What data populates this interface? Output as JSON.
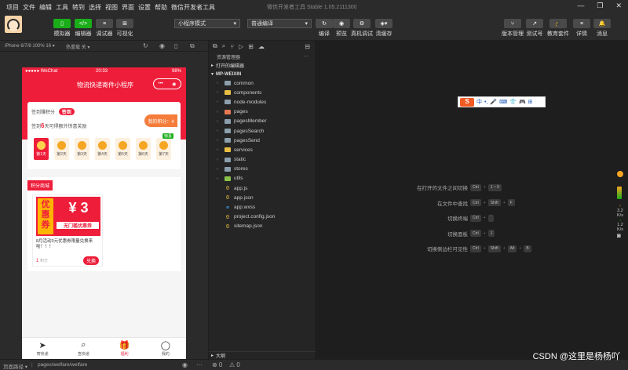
{
  "menu": [
    "项目",
    "文件",
    "编辑",
    "工具",
    "转到",
    "选择",
    "视图",
    "界面",
    "设置",
    "帮助",
    "微信开发者工具"
  ],
  "window_title": "微信开发者工具 Stable 1.05.2111300",
  "toolbar": {
    "left_buttons": [
      {
        "label": "模拟器",
        "icon": "phone-icon"
      },
      {
        "label": "编辑器",
        "icon": "code-icon"
      },
      {
        "label": "调试器",
        "icon": "debug-icon"
      },
      {
        "label": "可视化",
        "icon": "visual-icon"
      }
    ],
    "mode_select": "小程序模式",
    "compile_select": "普通编译",
    "mid_buttons": [
      "编译",
      "预览",
      "真机调试",
      "清缓存"
    ],
    "right_buttons": [
      "版本管理",
      "测试号",
      "教育套件",
      "详情",
      "消息"
    ]
  },
  "sim": {
    "device": "iPhone 6/7/8 100% 16 ▾",
    "hotreload": "热重载 关 ▾"
  },
  "phone": {
    "carrier": "●●●●● WeChat",
    "time": "20:33",
    "battery": "98%",
    "nav_title": "物流快递寄件小程序",
    "sign_text1": "签到赚积分",
    "sign_btn": "签到",
    "sign_text2_pre": "签到",
    "sign_days": "6",
    "sign_text2_post": "天可得额外惊喜奖励",
    "my_points": "我的积分：4",
    "days": [
      "第1天",
      "第2天",
      "第3天",
      "第4天",
      "第5天",
      "第6天",
      "第7天"
    ],
    "day7_tag": "惊喜",
    "shop_tag": "积分商城",
    "coupon_left": "优惠券",
    "coupon_amount": "¥ 3",
    "coupon_sub": "无门槛优惠券",
    "coupon_desc": "8月活动3元优惠券限量兑换来啦！！！",
    "coupon_cost": "1",
    "coupon_cost_unit": "积分",
    "exchange_btn": "兑换",
    "tabs": [
      "寄快递",
      "查快递",
      "福利",
      "我的"
    ]
  },
  "explorer": {
    "title": "资源管理器",
    "open_editors": "打开的编辑器",
    "project": "MP-WEIXIN",
    "items": [
      {
        "name": "common",
        "type": "folder",
        "color": "#8c9fad"
      },
      {
        "name": "components",
        "type": "folder",
        "color": "#e8bf43"
      },
      {
        "name": "node-modules",
        "type": "folder",
        "color": "#8c9fad"
      },
      {
        "name": "pages",
        "type": "folder",
        "color": "#e57a52"
      },
      {
        "name": "pagesMember",
        "type": "folder",
        "color": "#8c9fad"
      },
      {
        "name": "pagesSearch",
        "type": "folder",
        "color": "#8c9fad"
      },
      {
        "name": "pagesSend",
        "type": "folder",
        "color": "#8c9fad"
      },
      {
        "name": "services",
        "type": "folder",
        "color": "#e8bf43"
      },
      {
        "name": "static",
        "type": "folder",
        "color": "#8c9fad"
      },
      {
        "name": "stores",
        "type": "folder",
        "color": "#8c9fad"
      },
      {
        "name": "utils",
        "type": "folder",
        "color": "#8bc34a"
      },
      {
        "name": "app.js",
        "type": "js",
        "color": "#e8bf43"
      },
      {
        "name": "app.json",
        "type": "json",
        "color": "#e8bf43"
      },
      {
        "name": "app.wxss",
        "type": "wxss",
        "color": "#42a5f5"
      },
      {
        "name": "project.config.json",
        "type": "json",
        "color": "#e8bf43"
      },
      {
        "name": "sitemap.json",
        "type": "json",
        "color": "#e8bf43"
      }
    ],
    "outline": "大纲"
  },
  "editor": {
    "hints": [
      {
        "label": "在打开的文件之间切换",
        "keys": [
          "Ctrl",
          "1 ~ 9"
        ]
      },
      {
        "label": "在文件中查找",
        "keys": [
          "Ctrl",
          "Shift",
          "F"
        ]
      },
      {
        "label": "切换终端",
        "keys": [
          "Ctrl",
          "`"
        ]
      },
      {
        "label": "切换面板",
        "keys": [
          "Ctrl",
          "J"
        ]
      },
      {
        "label": "切换侧边栏可见性",
        "keys": [
          "Ctrl",
          "Shift",
          "Alt",
          "B"
        ]
      }
    ],
    "ime": [
      "S",
      "中",
      "•,",
      "🎤",
      "⌨",
      "👕",
      "🎮",
      "⊞"
    ]
  },
  "rightstrip": {
    "speed_up": "3.2",
    "unit_up": "K/s",
    "speed_down": "1.2",
    "unit_down": "K/s"
  },
  "bottom": {
    "path_label": "页面路径 ▾",
    "path": "pages/welfare/welfare"
  },
  "watermark": "CSDN @这里是杨杨吖"
}
